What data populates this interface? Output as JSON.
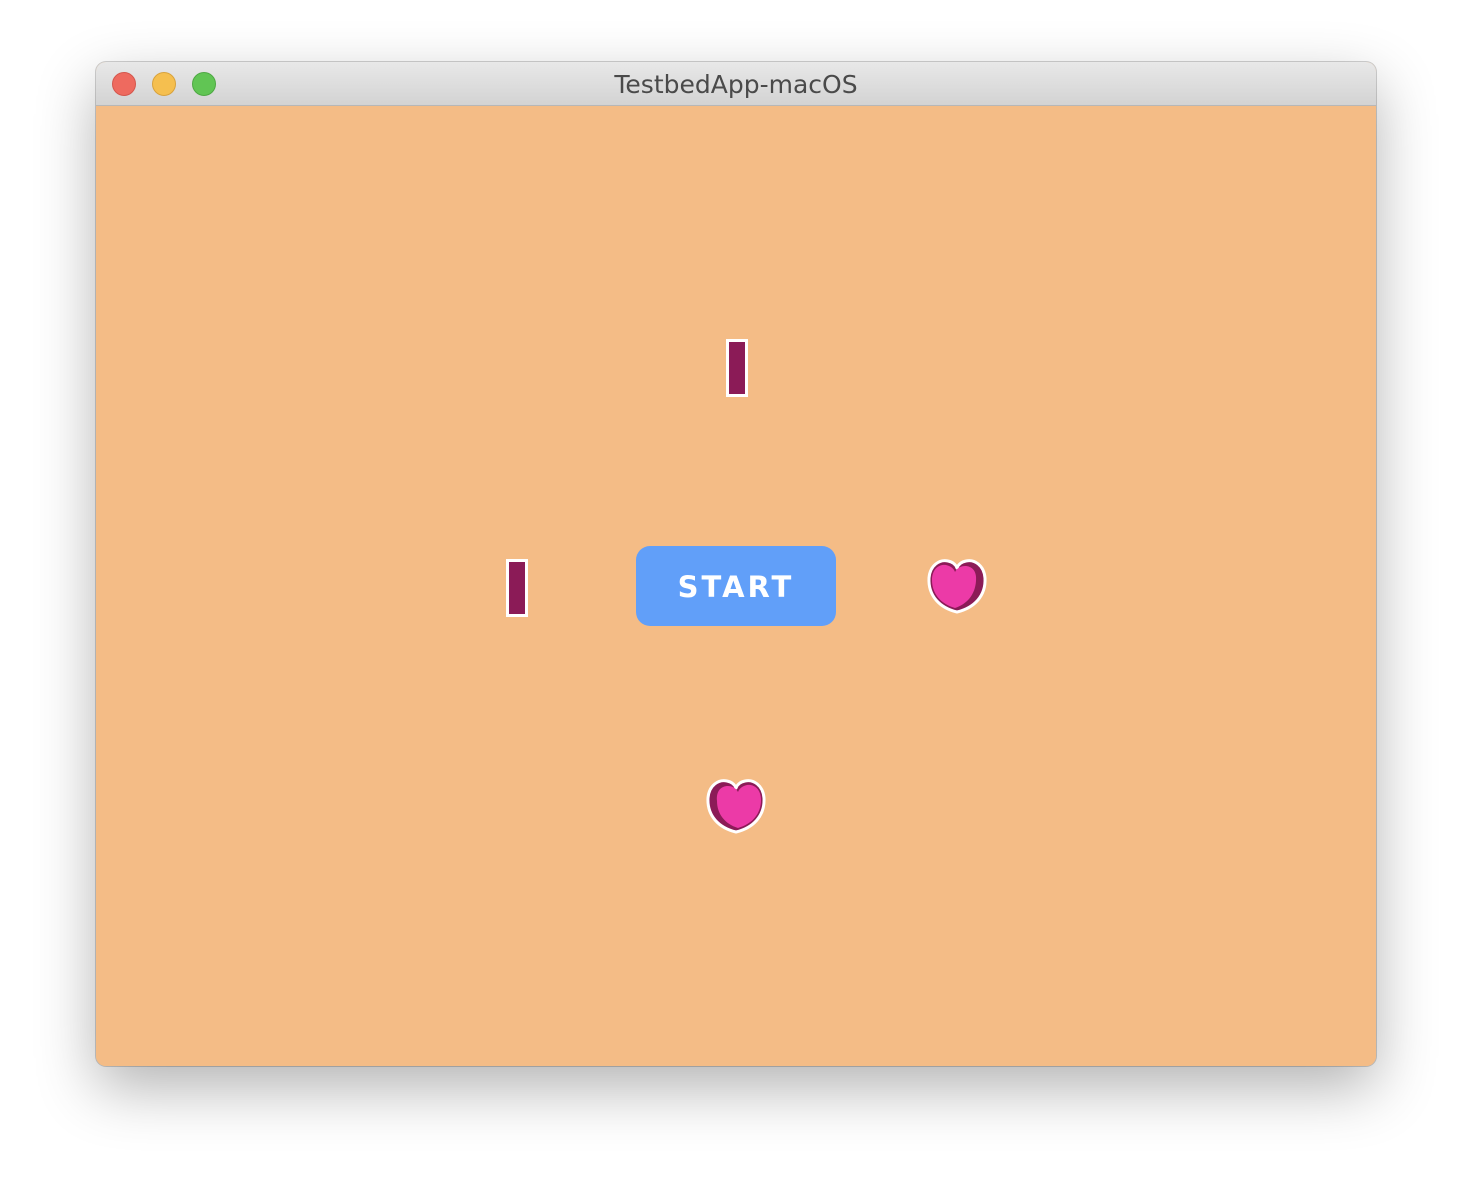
{
  "window": {
    "title": "TestbedApp-macOS"
  },
  "controls": {
    "close": "close-icon",
    "minimize": "minimize-icon",
    "zoom": "zoom-icon"
  },
  "scene": {
    "start_label": "START",
    "background_color": "#f4bc86",
    "button_color": "#619ff9",
    "sprites": [
      "bar-icon",
      "bar-icon",
      "heart-icon",
      "heart-icon"
    ],
    "sprite_colors": {
      "bar": "#8b1b57",
      "heart_fill": "#ec3aa7",
      "heart_shade": "#8b1b57",
      "outline": "#ffffff"
    }
  }
}
